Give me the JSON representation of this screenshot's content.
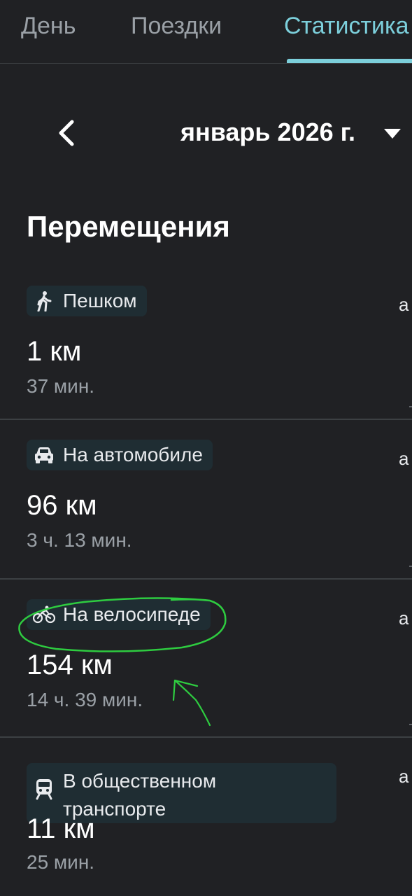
{
  "tabs": {
    "day": "День",
    "trips": "Поездки",
    "stats": "Статистика"
  },
  "month": {
    "label": "январь 2026 г."
  },
  "section": {
    "title": "Перемещения"
  },
  "cards": [
    {
      "mode": "Пешком",
      "icon": "walking-icon",
      "distance": "1 км",
      "duration": "37 мин.",
      "edge": "а"
    },
    {
      "mode": "На автомобиле",
      "icon": "car-icon",
      "distance": "96 км",
      "duration": "3 ч. 13 мин.",
      "edge": "а"
    },
    {
      "mode": "На велосипеде",
      "icon": "bicycle-icon",
      "distance": "154 км",
      "duration": "14 ч. 39 мин.",
      "edge": "а"
    },
    {
      "mode": "В общественном транспорте",
      "icon": "train-icon",
      "distance": "11 км",
      "duration": "25 мин.",
      "edge": "а"
    }
  ],
  "colors": {
    "background": "#202124",
    "accent": "#7ccfdb",
    "chip": "#1f2d33",
    "annotation": "#2ecc40"
  }
}
